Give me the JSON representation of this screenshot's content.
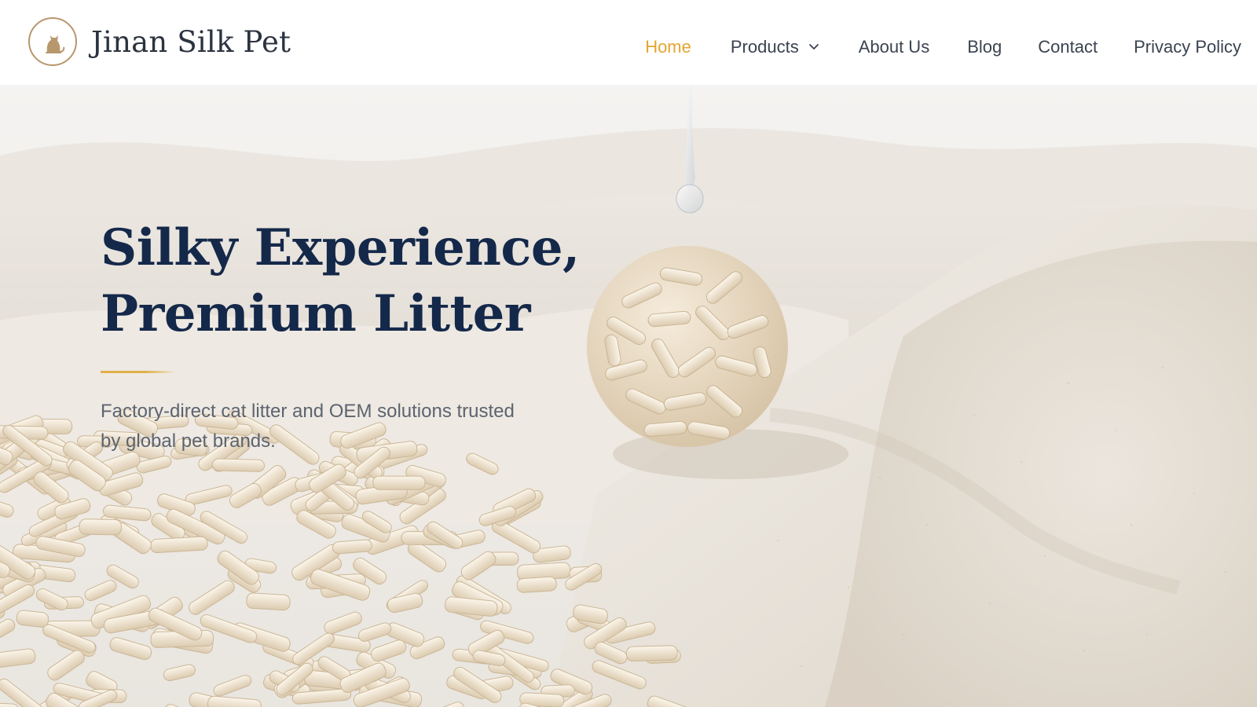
{
  "brand": {
    "name": "Jinan Silk Pet",
    "logo_icon": "cat-icon",
    "accent_color": "#b8976d"
  },
  "nav": {
    "items": [
      {
        "label": "Home",
        "active": true
      },
      {
        "label": "Products",
        "has_dropdown": true
      },
      {
        "label": "About Us"
      },
      {
        "label": "Blog"
      },
      {
        "label": "Contact"
      },
      {
        "label": "Privacy Policy"
      }
    ],
    "active_color": "#e3a52f",
    "text_color": "#3a4350"
  },
  "hero": {
    "title_line1": "Silky Experience,",
    "title_line2": "Premium Litter",
    "subtitle": "Factory-direct cat litter and OEM solutions trusted by global pet brands.",
    "title_color": "#14284a",
    "divider_color": "#e1b04a",
    "image": "white tofu cat litter pellets, clumped litter ball, water droplet, sand dunes"
  }
}
